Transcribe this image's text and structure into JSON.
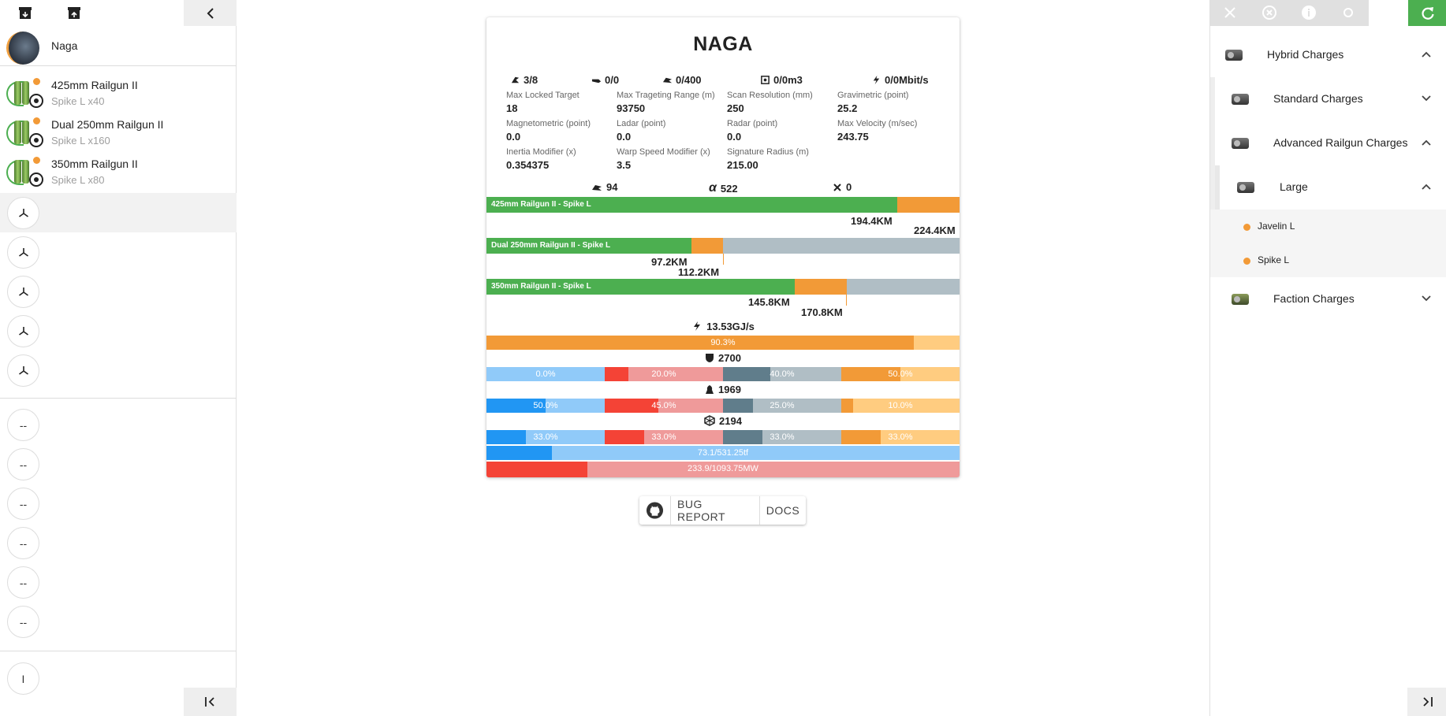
{
  "left": {
    "ship_name": "Naga",
    "modules": [
      {
        "title": "425mm Railgun II",
        "sub": "Spike L x40"
      },
      {
        "title": "Dual 250mm Railgun II",
        "sub": "Spike L x160"
      },
      {
        "title": "350mm Railgun II",
        "sub": "Spike L x80"
      }
    ],
    "mid_slot_label": "--",
    "low_slot_label": "I"
  },
  "card": {
    "title": "NAGA",
    "resources": [
      {
        "icon": "drone-icon",
        "value": "3/8"
      },
      {
        "icon": "launcher-icon",
        "value": "0/0"
      },
      {
        "icon": "turret-icon",
        "value": "0/400"
      },
      {
        "icon": "drone-bay-icon",
        "value": "0/0m3"
      },
      {
        "icon": "bandwidth-icon",
        "value": "0/0Mbit/s"
      }
    ],
    "stats": [
      {
        "label": "Max Locked Target",
        "value": "18"
      },
      {
        "label": "Max Trageting Range (m)",
        "value": "93750"
      },
      {
        "label": "Scan Resolution (mm)",
        "value": "250"
      },
      {
        "label": "Gravimetric (point)",
        "value": "25.2"
      },
      {
        "label": "Magnetometric (point)",
        "value": "0.0"
      },
      {
        "label": "Ladar (point)",
        "value": "0.0"
      },
      {
        "label": "Radar (point)",
        "value": "0.0"
      },
      {
        "label": "Max Velocity (m/sec)",
        "value": "243.75"
      },
      {
        "label": "Inertia Modifier (x)",
        "value": "0.354375"
      },
      {
        "label": "Warp Speed Modifier (x)",
        "value": "3.5"
      },
      {
        "label": "Signature Radius (m)",
        "value": "215.00"
      }
    ],
    "dps": [
      {
        "icon": "dps-icon",
        "value": "94"
      },
      {
        "icon": "alpha-icon",
        "value": "522"
      },
      {
        "icon": "drone-dps-icon",
        "value": "0"
      }
    ],
    "weapons": [
      {
        "label": "425mm Railgun II - Spike L",
        "optimal": "194.4KM",
        "falloff": "224.4KM",
        "opt_frac": 0.868,
        "fall_frac": 1.0
      },
      {
        "label": "Dual 250mm Railgun II - Spike L",
        "optimal": "97.2KM",
        "falloff": "112.2KM",
        "opt_frac": 0.434,
        "fall_frac": 0.5
      },
      {
        "label": "350mm Railgun II - Spike L",
        "optimal": "145.8KM",
        "falloff": "170.8KM",
        "opt_frac": 0.651,
        "fall_frac": 0.762
      }
    ],
    "capacitor": {
      "rate": "13.53GJ/s",
      "percent_label": "90.3%",
      "fraction": 0.903
    },
    "shield": {
      "hp": "2700",
      "resists": [
        {
          "label": "0.0%",
          "fraction": 0.0
        },
        {
          "label": "20.0%",
          "fraction": 0.2
        },
        {
          "label": "40.0%",
          "fraction": 0.4
        },
        {
          "label": "50.0%",
          "fraction": 0.5
        }
      ]
    },
    "armor": {
      "hp": "1969",
      "resists": [
        {
          "label": "50.0%",
          "fraction": 0.5
        },
        {
          "label": "45.0%",
          "fraction": 0.45
        },
        {
          "label": "25.0%",
          "fraction": 0.25
        },
        {
          "label": "10.0%",
          "fraction": 0.1
        }
      ]
    },
    "hull": {
      "hp": "2194",
      "resists": [
        {
          "label": "33.0%",
          "fraction": 0.33
        },
        {
          "label": "33.0%",
          "fraction": 0.33
        },
        {
          "label": "33.0%",
          "fraction": 0.33
        },
        {
          "label": "33.0%",
          "fraction": 0.33
        }
      ]
    },
    "cpu": {
      "label": "73.1/531.25tf",
      "fraction": 0.1376
    },
    "powergrid": {
      "label": "233.9/1093.75MW",
      "fraction": 0.2139
    }
  },
  "buttons": {
    "github_icon": "github-icon",
    "bug_report": "BUG REPORT",
    "docs": "DOCS"
  },
  "right": {
    "categories": {
      "hybrid": "Hybrid Charges",
      "standard": "Standard Charges",
      "advanced": "Advanced Railgun Charges",
      "large": "Large",
      "faction": "Faction Charges"
    },
    "ammo": [
      "Javelin L",
      "Spike L"
    ]
  },
  "colors": {
    "optimal": "#4caf50",
    "falloff": "#f29a37",
    "em": "#2196f3",
    "thermal": "#f44336",
    "kinetic": "#607d8b",
    "explosive": "#f29a37",
    "refresh": "#4caf50"
  }
}
